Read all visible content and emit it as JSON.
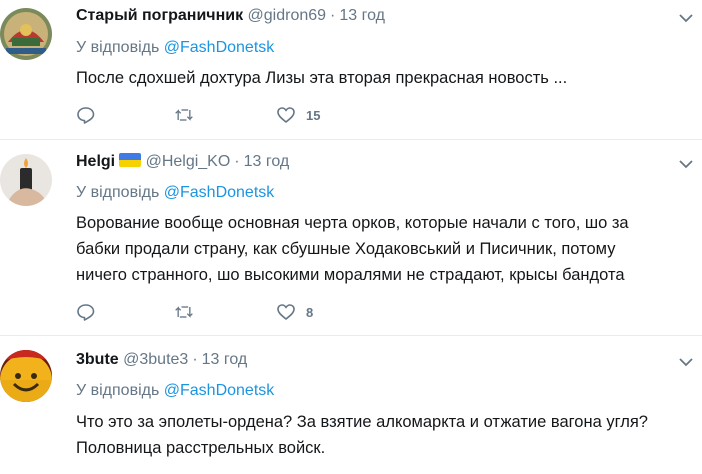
{
  "tweets": [
    {
      "name": "Старый пограничник",
      "handle": "@gidron69",
      "time": "13 год",
      "reply_prefix": "У відповідь",
      "reply_to": "@FashDonetsk",
      "text": "После сдохшей дохтура Лизы эта вторая прекрасная новость ...",
      "likes": "15"
    },
    {
      "name": "Helgi",
      "handle": "@Helgi_KO",
      "time": "13 год",
      "reply_prefix": "У відповідь",
      "reply_to": "@FashDonetsk",
      "text_lines": [
        "Ворование вообще основная черта орков, которые начали с того, шо за",
        "бабки продали страну, как сбушные Ходаковський и Писичник, потому",
        "ничего странного, шо высокими моралями не страдают, крысы бандота"
      ],
      "likes": "8",
      "flag_colors": [
        "#3f7ae5",
        "#f6d300"
      ]
    },
    {
      "name": "3bute",
      "handle": "@3bute3",
      "time": "13 год",
      "reply_prefix": "У відповідь",
      "reply_to": "@FashDonetsk",
      "text_lines": [
        "Что это за эполеты-ордена? За взятие алкомаркта и отжатие вагона угля?",
        "Половница расстрельных войск."
      ]
    }
  ],
  "colors": {
    "link": "#1b95e0",
    "muted": "#657786",
    "text": "#14171a",
    "divider": "#e6ecf0"
  },
  "icons": [
    "reply-icon",
    "retweet-icon",
    "like-icon",
    "chevron-down-icon"
  ]
}
